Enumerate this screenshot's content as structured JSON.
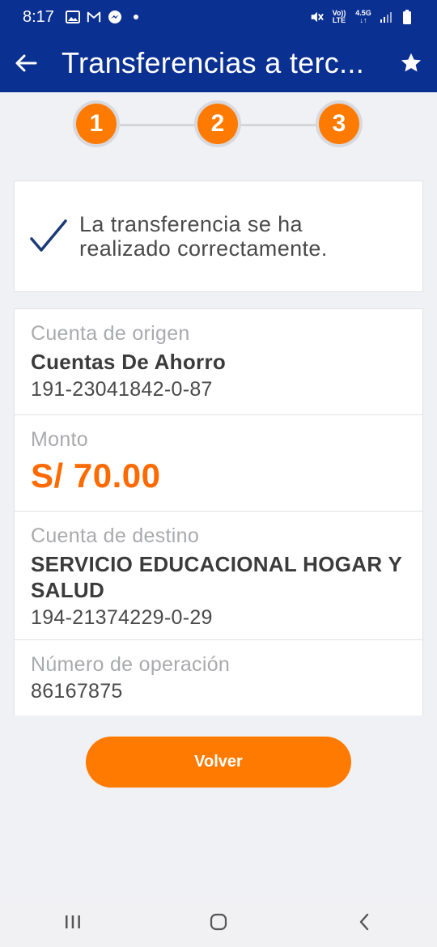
{
  "status_bar": {
    "time": "8:17",
    "left_icons": [
      "image-icon",
      "gmail-icon",
      "messenger-icon",
      "dot-icon"
    ],
    "right_icons": [
      "mute-icon",
      "volte-icon",
      "4g-signal-icon",
      "cell-signal-icon",
      "battery-icon"
    ],
    "volte_line1": "Vo))",
    "volte_line2": "LTE",
    "net_label": "4.5G"
  },
  "app_bar": {
    "title": "Transferencias a terc...",
    "back_icon": "arrow-left-icon",
    "favorite_icon": "star-icon"
  },
  "stepper": {
    "steps": [
      "1",
      "2",
      "3"
    ]
  },
  "success": {
    "message": "La transferencia se ha realizado correctamente."
  },
  "details": {
    "origin": {
      "label": "Cuenta de origen",
      "type": "Cuentas De Ahorro",
      "number": "191-23041842-0-87"
    },
    "amount": {
      "label": "Monto",
      "value": "S/ 70.00"
    },
    "destination": {
      "label": "Cuenta de destino",
      "name": "SERVICIO EDUCACIONAL HOGAR Y SALUD",
      "number": "194-21374229-0-29"
    },
    "operation": {
      "label": "Número de operación",
      "value": "86167875"
    }
  },
  "actions": {
    "back_label": "Volver"
  },
  "colors": {
    "primary": "#0a3092",
    "accent": "#ff7a00",
    "amount": "#ff6a00"
  }
}
